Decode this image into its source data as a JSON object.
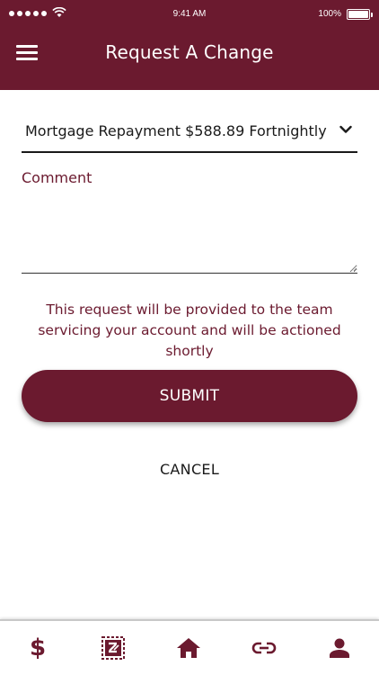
{
  "status_bar": {
    "time": "9:41 AM",
    "battery": "100%"
  },
  "header": {
    "title": "Request A Change",
    "menu_icon": "hamburger-menu-icon"
  },
  "form": {
    "select_value": "Mortgage Repayment $588.89 Fortnightly",
    "comment_label": "Comment",
    "comment_value": "",
    "notice": "This request will be provided to the team servicing your account and will be actioned shortly",
    "submit_label": "SUBMIT",
    "cancel_label": "CANCEL"
  },
  "tabbar": {
    "items": [
      {
        "icon": "dollar-icon",
        "glyph": "$"
      },
      {
        "icon": "request-change-icon"
      },
      {
        "icon": "home-icon"
      },
      {
        "icon": "link-icon"
      },
      {
        "icon": "profile-icon"
      }
    ]
  },
  "colors": {
    "brand": "#6b1a2f",
    "background": "#ffffff",
    "text": "#1a1a1a"
  }
}
